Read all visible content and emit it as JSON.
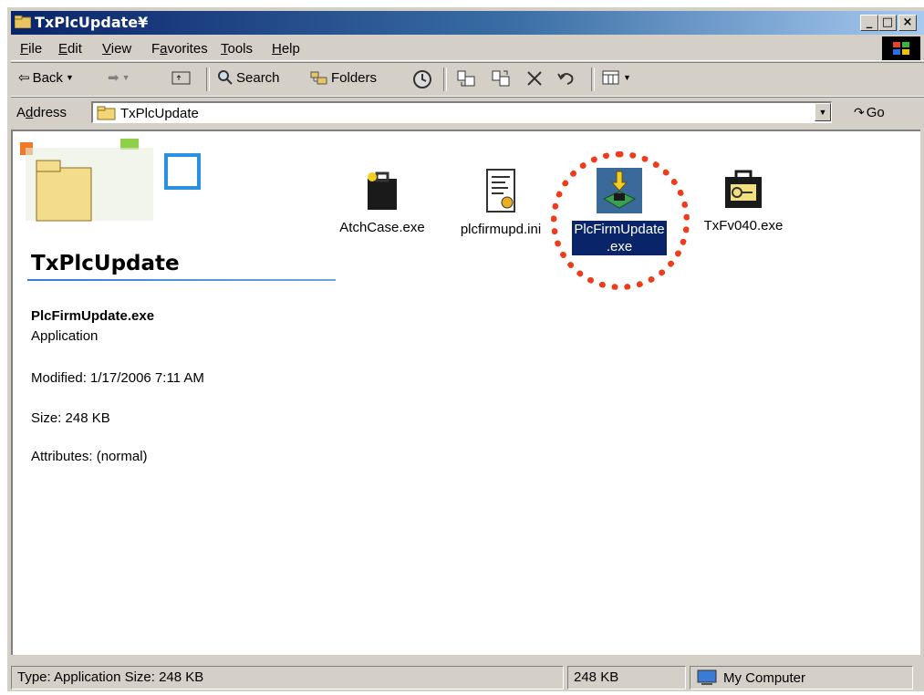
{
  "window": {
    "title": "TxPlcUpdate¥"
  },
  "menu": [
    {
      "label": "File",
      "u": "F",
      "rest": "ile"
    },
    {
      "label": "Edit",
      "u": "E",
      "rest": "dit"
    },
    {
      "label": "View",
      "u": "V",
      "rest": "iew"
    },
    {
      "label": "Favorites",
      "pre": "F",
      "u": "a",
      "rest": "vorites"
    },
    {
      "label": "Tools",
      "u": "T",
      "rest": "ools"
    },
    {
      "label": "Help",
      "u": "H",
      "rest": "elp"
    }
  ],
  "toolbar": {
    "back": "Back",
    "search": "Search",
    "folders": "Folders"
  },
  "address": {
    "label_pre": "A",
    "label_u": "d",
    "label_rest": "dress",
    "value": "TxPlcUpdate",
    "go": "Go"
  },
  "sidebar": {
    "folder_title": "TxPlcUpdate",
    "selected_name": "PlcFirmUpdate.exe",
    "selected_type": "Application",
    "modified": "Modified: 1/17/2006 7:11 AM",
    "size": "Size: 248 KB",
    "attributes": "Attributes: (normal)"
  },
  "files": [
    {
      "name": "AtchCase.exe",
      "icon": "briefcase-icon"
    },
    {
      "name": "plcfirmupd.ini",
      "icon": "config-file-icon"
    },
    {
      "name_line1": "PlcFirmUpdate",
      "name_line2": ".exe",
      "icon": "firmware-update-icon",
      "selected": true
    },
    {
      "name": "TxFv040.exe",
      "icon": "key-case-icon"
    }
  ],
  "status": {
    "info": "Type: Application Size: 248 KB",
    "size": "248 KB",
    "zone": "My Computer"
  },
  "colors": {
    "title_start": "#0a246a",
    "title_end": "#a6caf0",
    "selection": "#0a246a",
    "highlight_circle": "#ef3b1a"
  }
}
